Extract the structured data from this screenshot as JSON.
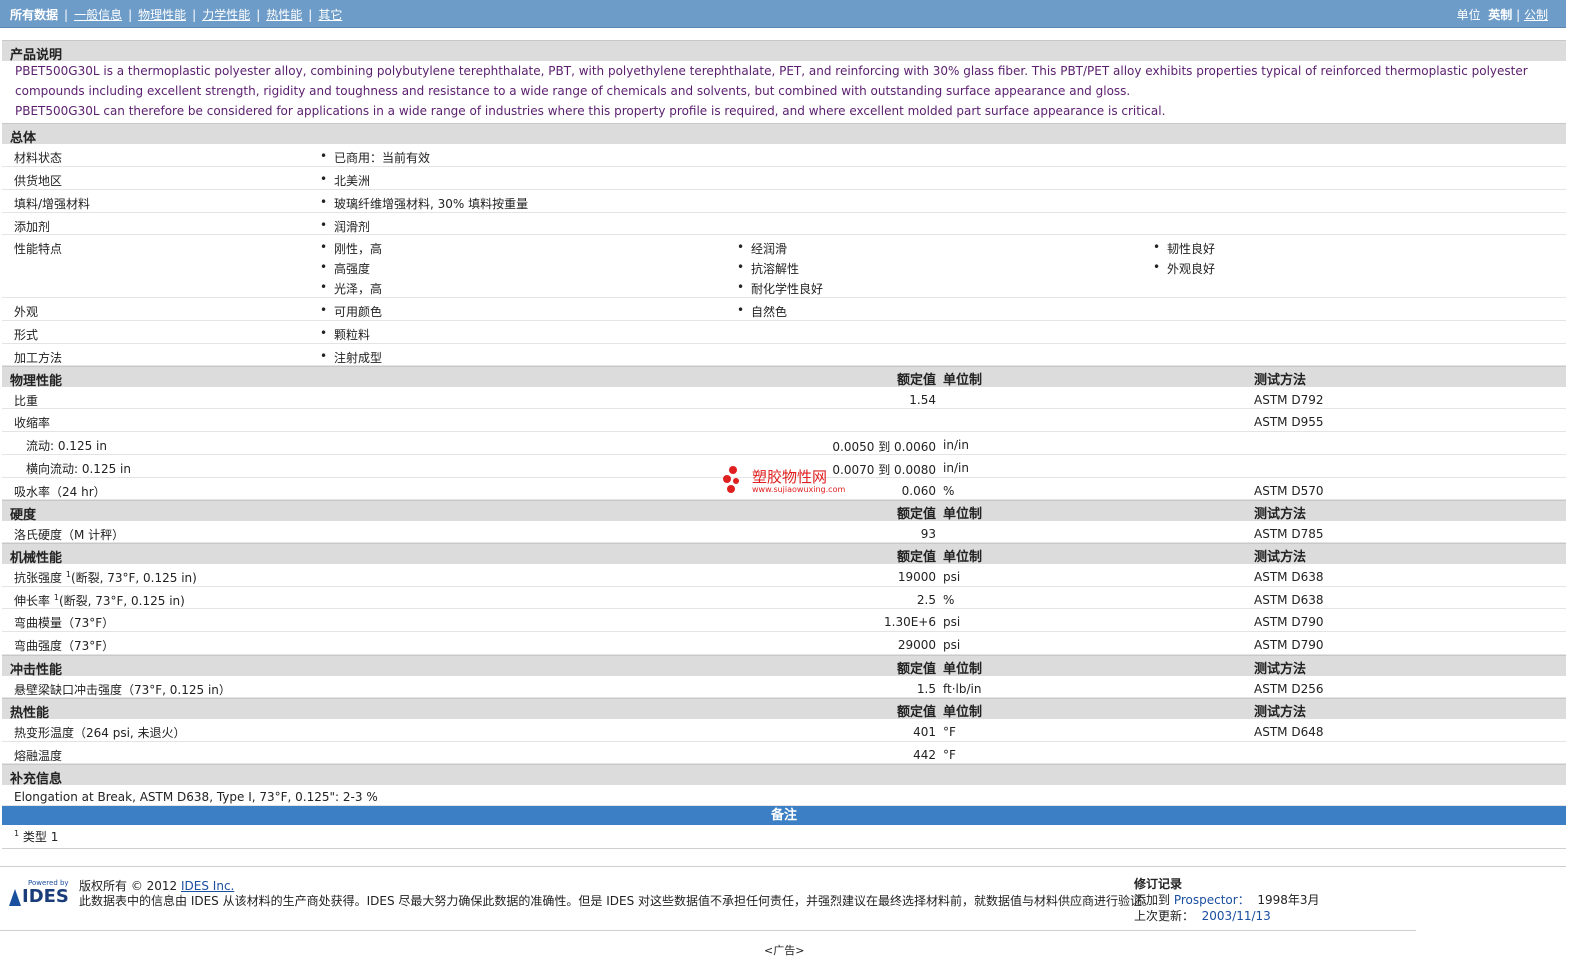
{
  "nav": {
    "items": [
      "所有数据",
      "一般信息",
      "物理性能",
      "力学性能",
      "热性能",
      "其它"
    ],
    "sep": "|"
  },
  "units": {
    "label": "单位",
    "imperial": "英制",
    "sep": "|",
    "metric": "公制"
  },
  "sections": {
    "desc_title": "产品说明",
    "desc_p1": "PBET500G30L is a thermoplastic polyester alloy, combining polybutylene terephthalate, PBT, with polyethylene terephthalate, PET, and reinforcing with 30% glass fiber. This PBT/PET alloy exhibits properties typical of reinforced thermoplastic polyester compounds including excellent strength, rigidity and toughness and resistance to a wide range of chemicals and solvents, but combined with outstanding surface appearance and gloss.",
    "desc_p2": "PBET500G30L can therefore be considered for applications in a wide range of industries where this property profile is required, and where excellent molded part surface appearance is critical.",
    "general_title": "总体",
    "general": [
      {
        "label": "材料状态",
        "values": [
          "已商用：当前有效"
        ]
      },
      {
        "label": "供货地区",
        "values": [
          "北美洲"
        ]
      },
      {
        "label": "填料/增强材料",
        "values": [
          "玻璃纤维增强材料, 30% 填料按重量"
        ]
      },
      {
        "label": "添加剂",
        "values": [
          "润滑剂"
        ]
      },
      {
        "label": "性能特点",
        "values": [
          "刚性，高",
          "高强度",
          "光泽，高",
          "经润滑",
          "抗溶解性",
          "耐化学性良好",
          "韧性良好",
          "外观良好"
        ]
      },
      {
        "label": "外观",
        "values": [
          "可用颜色",
          "自然色"
        ]
      },
      {
        "label": "形式",
        "values": [
          "颗粒料"
        ]
      },
      {
        "label": "加工方法",
        "values": [
          "注射成型"
        ]
      }
    ],
    "col_value": "额定值",
    "col_unit": "单位制",
    "col_method": "测试方法",
    "physical_title": "物理性能",
    "physical": [
      {
        "label": "比重",
        "value": "1.54",
        "unit": "",
        "method": "ASTM D792"
      },
      {
        "label": "收缩率",
        "value": "",
        "unit": "",
        "method": "ASTM D955"
      },
      {
        "label": "流动: 0.125 in",
        "value": "0.0050 到  0.0060",
        "unit": "in/in",
        "method": ""
      },
      {
        "label": "横向流动: 0.125 in",
        "value": "0.0070 到  0.0080",
        "unit": "in/in",
        "method": ""
      },
      {
        "label": "吸水率（24 hr）",
        "value": "0.060",
        "unit": "%",
        "method": "ASTM D570"
      }
    ],
    "hardness_title": "硬度",
    "hardness": [
      {
        "label": "洛氏硬度（M 计秤）",
        "value": "93",
        "unit": "",
        "method": "ASTM D785"
      }
    ],
    "mech_title": "机械性能",
    "mech": [
      {
        "label": "抗张强度",
        "sup": "1",
        "extra": "(断裂, 73°F, 0.125 in)",
        "value": "19000",
        "unit": "psi",
        "method": "ASTM D638"
      },
      {
        "label": "伸长率",
        "sup": "1",
        "extra": "(断裂, 73°F, 0.125 in)",
        "value": "2.5",
        "unit": "%",
        "method": "ASTM D638"
      },
      {
        "label": "弯曲模量（73°F）",
        "sup": "",
        "extra": "",
        "value": "1.30E+6",
        "unit": "psi",
        "method": "ASTM D790"
      },
      {
        "label": "弯曲强度（73°F）",
        "sup": "",
        "extra": "",
        "value": "29000",
        "unit": "psi",
        "method": "ASTM D790"
      }
    ],
    "impact_title": "冲击性能",
    "impact": [
      {
        "label": "悬壁梁缺口冲击强度（73°F, 0.125 in）",
        "value": "1.5",
        "unit": "ft·lb/in",
        "method": "ASTM D256"
      }
    ],
    "thermal_title": "热性能",
    "thermal": [
      {
        "label": "热变形温度（264 psi, 未退火）",
        "value": "401",
        "unit": "°F",
        "method": "ASTM D648"
      },
      {
        "label": "熔融温度",
        "value": "442",
        "unit": "°F",
        "method": ""
      }
    ],
    "supp_title": "补充信息",
    "supp_text": "Elongation at Break, ASTM D638, Type I, 73°F, 0.125\": 2-3 %",
    "notes_title": "备注",
    "note_sup": "1",
    "note_text": "类型   1"
  },
  "watermark": {
    "title": "塑胶物性网",
    "url": "www.sujiaowuxing.com",
    "color": "#e02020"
  },
  "footer": {
    "logo_powered": "Powered by",
    "logo_text": "IDES",
    "copyright": "版权所有 © 2012",
    "company": "IDES Inc.",
    "disclaimer": "此数据表中的信息由 IDES 从该材料的生产商处获得。IDES 尽最大努力确保此数据的准确性。但是 IDES 对这些数据值不承担任何责任，并强烈建议在最终选择材料前，就数据值与材料供应商进行验证。",
    "rev_title": "修订记录",
    "added_label": "添加到 ",
    "added_where": "Prospector：",
    "added_date": "1998年3月",
    "updated_label": "上次更新：",
    "updated_date": "2003/11/13",
    "ad": "<广告>"
  }
}
